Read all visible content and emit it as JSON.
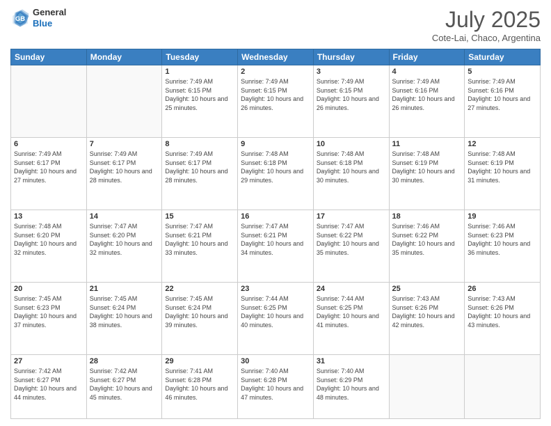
{
  "header": {
    "logo_general": "General",
    "logo_blue": "Blue",
    "month_title": "July 2025",
    "subtitle": "Cote-Lai, Chaco, Argentina"
  },
  "weekdays": [
    "Sunday",
    "Monday",
    "Tuesday",
    "Wednesday",
    "Thursday",
    "Friday",
    "Saturday"
  ],
  "weeks": [
    [
      null,
      null,
      {
        "day": 1,
        "sunrise": "Sunrise: 7:49 AM",
        "sunset": "Sunset: 6:15 PM",
        "daylight": "Daylight: 10 hours and 25 minutes."
      },
      {
        "day": 2,
        "sunrise": "Sunrise: 7:49 AM",
        "sunset": "Sunset: 6:15 PM",
        "daylight": "Daylight: 10 hours and 26 minutes."
      },
      {
        "day": 3,
        "sunrise": "Sunrise: 7:49 AM",
        "sunset": "Sunset: 6:15 PM",
        "daylight": "Daylight: 10 hours and 26 minutes."
      },
      {
        "day": 4,
        "sunrise": "Sunrise: 7:49 AM",
        "sunset": "Sunset: 6:16 PM",
        "daylight": "Daylight: 10 hours and 26 minutes."
      },
      {
        "day": 5,
        "sunrise": "Sunrise: 7:49 AM",
        "sunset": "Sunset: 6:16 PM",
        "daylight": "Daylight: 10 hours and 27 minutes."
      }
    ],
    [
      {
        "day": 6,
        "sunrise": "Sunrise: 7:49 AM",
        "sunset": "Sunset: 6:17 PM",
        "daylight": "Daylight: 10 hours and 27 minutes."
      },
      {
        "day": 7,
        "sunrise": "Sunrise: 7:49 AM",
        "sunset": "Sunset: 6:17 PM",
        "daylight": "Daylight: 10 hours and 28 minutes."
      },
      {
        "day": 8,
        "sunrise": "Sunrise: 7:49 AM",
        "sunset": "Sunset: 6:17 PM",
        "daylight": "Daylight: 10 hours and 28 minutes."
      },
      {
        "day": 9,
        "sunrise": "Sunrise: 7:48 AM",
        "sunset": "Sunset: 6:18 PM",
        "daylight": "Daylight: 10 hours and 29 minutes."
      },
      {
        "day": 10,
        "sunrise": "Sunrise: 7:48 AM",
        "sunset": "Sunset: 6:18 PM",
        "daylight": "Daylight: 10 hours and 30 minutes."
      },
      {
        "day": 11,
        "sunrise": "Sunrise: 7:48 AM",
        "sunset": "Sunset: 6:19 PM",
        "daylight": "Daylight: 10 hours and 30 minutes."
      },
      {
        "day": 12,
        "sunrise": "Sunrise: 7:48 AM",
        "sunset": "Sunset: 6:19 PM",
        "daylight": "Daylight: 10 hours and 31 minutes."
      }
    ],
    [
      {
        "day": 13,
        "sunrise": "Sunrise: 7:48 AM",
        "sunset": "Sunset: 6:20 PM",
        "daylight": "Daylight: 10 hours and 32 minutes."
      },
      {
        "day": 14,
        "sunrise": "Sunrise: 7:47 AM",
        "sunset": "Sunset: 6:20 PM",
        "daylight": "Daylight: 10 hours and 32 minutes."
      },
      {
        "day": 15,
        "sunrise": "Sunrise: 7:47 AM",
        "sunset": "Sunset: 6:21 PM",
        "daylight": "Daylight: 10 hours and 33 minutes."
      },
      {
        "day": 16,
        "sunrise": "Sunrise: 7:47 AM",
        "sunset": "Sunset: 6:21 PM",
        "daylight": "Daylight: 10 hours and 34 minutes."
      },
      {
        "day": 17,
        "sunrise": "Sunrise: 7:47 AM",
        "sunset": "Sunset: 6:22 PM",
        "daylight": "Daylight: 10 hours and 35 minutes."
      },
      {
        "day": 18,
        "sunrise": "Sunrise: 7:46 AM",
        "sunset": "Sunset: 6:22 PM",
        "daylight": "Daylight: 10 hours and 35 minutes."
      },
      {
        "day": 19,
        "sunrise": "Sunrise: 7:46 AM",
        "sunset": "Sunset: 6:23 PM",
        "daylight": "Daylight: 10 hours and 36 minutes."
      }
    ],
    [
      {
        "day": 20,
        "sunrise": "Sunrise: 7:45 AM",
        "sunset": "Sunset: 6:23 PM",
        "daylight": "Daylight: 10 hours and 37 minutes."
      },
      {
        "day": 21,
        "sunrise": "Sunrise: 7:45 AM",
        "sunset": "Sunset: 6:24 PM",
        "daylight": "Daylight: 10 hours and 38 minutes."
      },
      {
        "day": 22,
        "sunrise": "Sunrise: 7:45 AM",
        "sunset": "Sunset: 6:24 PM",
        "daylight": "Daylight: 10 hours and 39 minutes."
      },
      {
        "day": 23,
        "sunrise": "Sunrise: 7:44 AM",
        "sunset": "Sunset: 6:25 PM",
        "daylight": "Daylight: 10 hours and 40 minutes."
      },
      {
        "day": 24,
        "sunrise": "Sunrise: 7:44 AM",
        "sunset": "Sunset: 6:25 PM",
        "daylight": "Daylight: 10 hours and 41 minutes."
      },
      {
        "day": 25,
        "sunrise": "Sunrise: 7:43 AM",
        "sunset": "Sunset: 6:26 PM",
        "daylight": "Daylight: 10 hours and 42 minutes."
      },
      {
        "day": 26,
        "sunrise": "Sunrise: 7:43 AM",
        "sunset": "Sunset: 6:26 PM",
        "daylight": "Daylight: 10 hours and 43 minutes."
      }
    ],
    [
      {
        "day": 27,
        "sunrise": "Sunrise: 7:42 AM",
        "sunset": "Sunset: 6:27 PM",
        "daylight": "Daylight: 10 hours and 44 minutes."
      },
      {
        "day": 28,
        "sunrise": "Sunrise: 7:42 AM",
        "sunset": "Sunset: 6:27 PM",
        "daylight": "Daylight: 10 hours and 45 minutes."
      },
      {
        "day": 29,
        "sunrise": "Sunrise: 7:41 AM",
        "sunset": "Sunset: 6:28 PM",
        "daylight": "Daylight: 10 hours and 46 minutes."
      },
      {
        "day": 30,
        "sunrise": "Sunrise: 7:40 AM",
        "sunset": "Sunset: 6:28 PM",
        "daylight": "Daylight: 10 hours and 47 minutes."
      },
      {
        "day": 31,
        "sunrise": "Sunrise: 7:40 AM",
        "sunset": "Sunset: 6:29 PM",
        "daylight": "Daylight: 10 hours and 48 minutes."
      },
      null,
      null
    ]
  ]
}
